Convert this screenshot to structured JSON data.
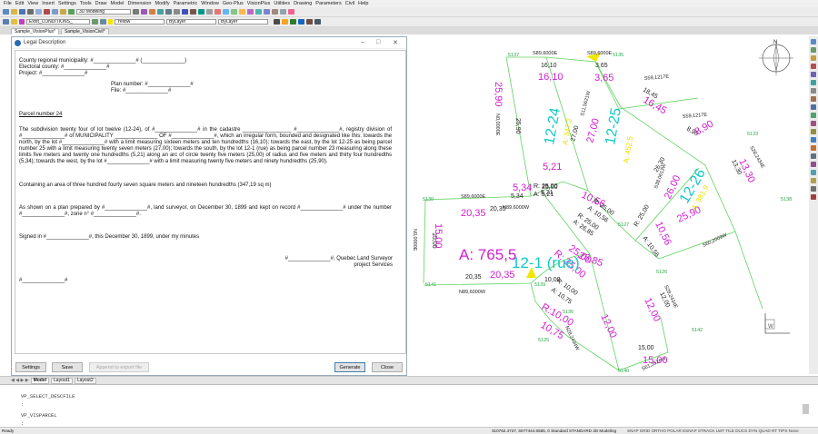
{
  "menu": [
    "File",
    "Edit",
    "View",
    "Insert",
    "Settings",
    "Tools",
    "Draw",
    "Model",
    "Dimension",
    "Modify",
    "Parametric",
    "Window",
    "Geo-Plus",
    "VisionPlus",
    "Utilities",
    "Drawing",
    "Parameters",
    "Civil",
    "Help"
  ],
  "toolbar": {
    "workspace": "3D Modeling",
    "layer": "Exist_CONDITIONS_",
    "color": "Yellow",
    "linetype": "ByLayer",
    "lineweight": "ByLayer"
  },
  "doc_tabs": [
    "Sample_VisionPlus*",
    "Sample_VisionCivil*"
  ],
  "dialog": {
    "title": "Legal Description",
    "buttons": {
      "settings": "Settings",
      "save": "Save",
      "append": "Append to export file",
      "generate": "Generate",
      "close": "Close"
    },
    "doc": {
      "header_lines": [
        "County regional municipality: #______________# (______________)",
        "Electoral county: #______________#",
        "Project: #______________#"
      ],
      "plan_number": "Plan number: #______________#",
      "file": "File: #______________#",
      "parcel_title": "Parcel number 24",
      "paragraph1": "The subdivision twenty four of lot twelve (12-24), of #______________# in the cadastre ________________ #______________#, registry division of #______________# of MUNICIPALITY ______________ OF #______________#, which an irregular form, bounded and designated like this: towards the north, by the lot #______________# with a limit measuring sixteen meters and ten hundredths (16,10); towards the east, by the lot 12-25 as being parcel number 25 with a limit measuring twenty seven meters (27,00); towards the south, by the lot 12-1 (rue) as being parcel number 23 measuring along these limits five meters and twenty one hundredths (5,21) along an arc of circle twenty five meters (25,00) of radius and five meters and thirty four hundredths (5,34); towards the west, by the lot #______________# with a limit measuring twenty five meters and ninety hundredths (25,90).",
      "paragraph2": "Containing an area of three hundred fourty seven square meters and nineteen hundredths (347,19 sq m)",
      "paragraph3": "As shown on a plan prepared by #______________#, land surveyor, on December 30, 1899 and kept on record #______________# under the number #______________#, zone n° #______________#.",
      "paragraph4": "Signed in #______________#, this December 30, 1899, under my minutes",
      "signature_name": "#______________#, Quebec Land Surveyor",
      "signature_org": "project Services",
      "footer_placeholder": "#______________#"
    }
  },
  "layout_tabs": [
    "Model",
    "Layout1",
    "Layout2"
  ],
  "command_lines": [
    "VP_SELECT_DESCFILE",
    ":",
    "VP_VISPARCEL",
    ":"
  ],
  "status_bar": {
    "ready": "Ready",
    "coords": "310762.4727, 5077444.6585, 0  Standard  STANDARD  3D Modeling",
    "toggles": "SNAP  GRID  ORTHO  POLAR  ESNAP  STRACK  LWT  TILE  DUCS  DYN  QUAD  RT  TIPS  None"
  },
  "compass": "N",
  "ucs_label": "W",
  "drawing_labels": {
    "points": [
      "5137",
      "5135",
      "5133",
      "5138",
      "5130",
      "5127",
      "5126",
      "5141",
      "5139",
      "5136",
      "5125",
      "5142",
      "5140"
    ],
    "bearings": [
      "S89,6000E",
      "S89,6000E",
      "S59,1217E",
      "S59,1217E",
      "S28,2434E",
      "N0,0000E",
      "S11,5621W",
      "S38,0613W",
      "S89,6000E",
      "N89,6000W",
      "N0,0000E",
      "S60,2009W",
      "N89,6000W",
      "S28,2434E",
      "N28,2434W",
      "S61,3526W"
    ],
    "dims_small": [
      "16,10",
      "3,65",
      "18,45",
      "8,90",
      "13,30",
      "25,90",
      "27,00",
      "5,34",
      "5,21",
      "26,30",
      "20,35",
      "25,00",
      "15,00",
      "20,35",
      "10,00",
      "12,00",
      "15,00"
    ],
    "dims_magenta": [
      "16,10",
      "3,65",
      "16,45",
      "8,90",
      "13,30",
      "25,90",
      "27,00",
      "5,21",
      "5,34",
      "10,56",
      "26,85",
      "25,00",
      "26,00",
      "25,90",
      "10,56",
      "20,35",
      "15,00",
      "20,35",
      "12,00",
      "10,75",
      "12,00",
      "15,00"
    ],
    "arcs": [
      "R: 25,00",
      "A: 5,21",
      "R: 25,00",
      "A: 10,56",
      "R: 25,00",
      "A: 26,85",
      "R: 25,00",
      "A: 10,56",
      "R: 10,00",
      "A: 10,75",
      "R:10,00",
      "R: 25,00"
    ],
    "parcels": [
      {
        "name": "12-24",
        "area": "A: 347,2"
      },
      {
        "name": "12-25",
        "area": "A: 452,5"
      },
      {
        "name": "12-26",
        "area": "A: 381,9"
      },
      {
        "name": "12-1 (rue)",
        "area": "A: 765,5"
      }
    ]
  }
}
